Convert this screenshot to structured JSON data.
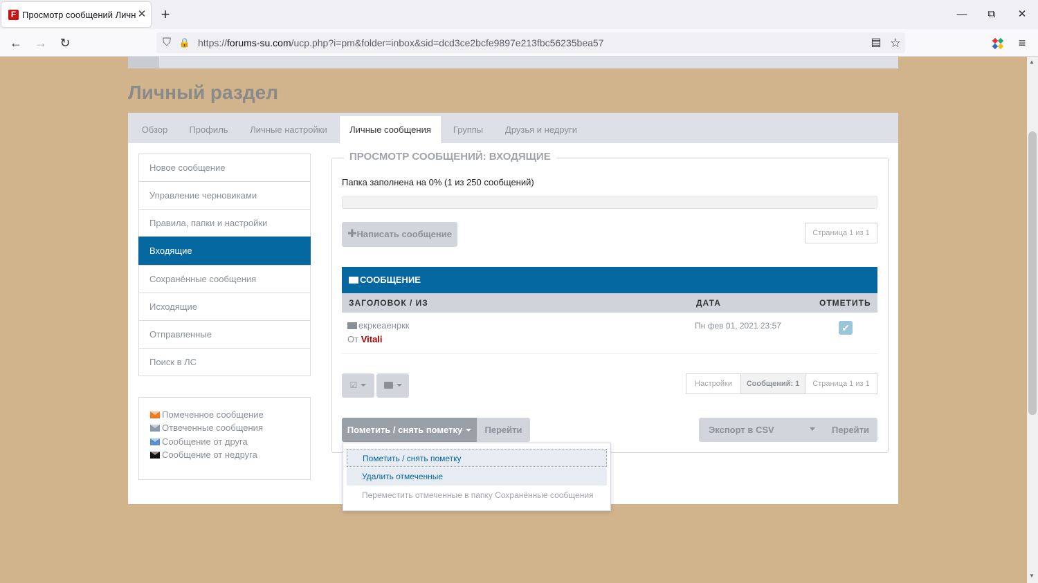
{
  "browser": {
    "tab_title": "Просмотр сообщений Личны",
    "tab_close": "✕",
    "new_tab": "+",
    "url_host_prefix": "https://",
    "url_host": "forums-su.com",
    "url_path": "/ucp.php?i=pm&folder=inbox&sid=dcd3ce2bcfe9897e213fbc56235bea57",
    "win_minimize": "—",
    "win_restore": "⧉",
    "win_close": "✕",
    "back": "←",
    "forward": "→",
    "reload": "↻",
    "reader": "▤",
    "star": "☆",
    "menu": "≡",
    "shield": "⛉",
    "lock": "🔒"
  },
  "page": {
    "title": "Личный раздел",
    "tabs": [
      {
        "label": "Обзор"
      },
      {
        "label": "Профиль"
      },
      {
        "label": "Личные настройки"
      },
      {
        "label": "Личные сообщения"
      },
      {
        "label": "Группы"
      },
      {
        "label": "Друзья и недруги"
      }
    ],
    "sidebar": [
      {
        "label": "Новое сообщение"
      },
      {
        "label": "Управление черновиками"
      },
      {
        "label": "Правила, папки и настройки"
      },
      {
        "label": "Входящие"
      },
      {
        "label": "Сохранённые сообщения"
      },
      {
        "label": "Исходящие"
      },
      {
        "label": "Отправленные"
      },
      {
        "label": "Поиск в ЛС"
      }
    ],
    "legend": [
      {
        "label": "Помеченное сообщение",
        "color": "#f07b1e"
      },
      {
        "label": "Отвеченные сообщения",
        "color": "#8a9aae"
      },
      {
        "label": "Сообщение от друга",
        "color": "#5b8fc9"
      },
      {
        "label": "Сообщение от недруга",
        "color": "#111111"
      }
    ]
  },
  "inbox": {
    "heading": "ПРОСМОТР СООБЩЕНИЙ: ВХОДЯЩИЕ",
    "folder_status": "Папка заполнена на 0% (1 из 250 сообщений)",
    "fill_percent": 0,
    "compose_button": "Написать сообщение",
    "pagination_top": "Страница 1 из 1",
    "table": {
      "header": "СООБЩЕНИЕ",
      "col_subject": "ЗАГОЛОВОК / ИЗ",
      "col_date": "ДАТА",
      "col_mark": "ОТМЕТИТЬ",
      "rows": [
        {
          "subject": "екркеаенркк",
          "from_prefix": "От",
          "author": "Vitali",
          "date": "Пн фев 01, 2021 23:57",
          "checked": true
        }
      ]
    },
    "footer": {
      "settings": "Настройки",
      "count": "Сообщений: 1",
      "pagination": "Страница 1 из 1"
    },
    "actions": {
      "mark_select": "Пометить / снять пометку",
      "go": "Перейти",
      "export_select": "Экспорт в CSV",
      "go2": "Перейти"
    },
    "dropdown": [
      {
        "label": "Пометить / снять пометку"
      },
      {
        "label": "Удалить отмеченные"
      },
      {
        "label": "Переместить отмеченные в папку Сохранённые сообщения"
      }
    ]
  }
}
